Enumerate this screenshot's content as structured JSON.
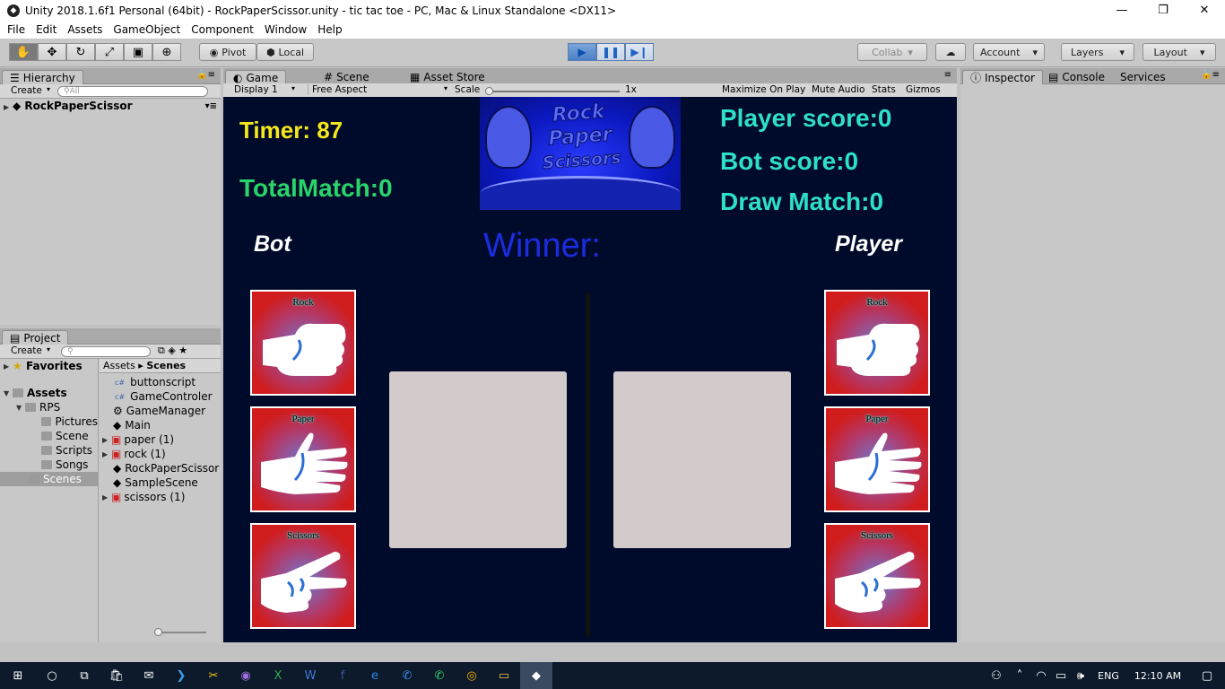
{
  "window": {
    "title": "Unity 2018.1.6f1 Personal (64bit) - RockPaperScissor.unity - tic tac toe - PC, Mac & Linux Standalone <DX11>"
  },
  "menu": [
    "File",
    "Edit",
    "Assets",
    "GameObject",
    "Component",
    "Window",
    "Help"
  ],
  "toolbar": {
    "pivot": "Pivot",
    "local": "Local",
    "collab": "Collab",
    "account": "Account",
    "layers": "Layers",
    "layout": "Layout"
  },
  "hierarchy": {
    "tab": "Hierarchy",
    "create": "Create",
    "search_placeholder": "All",
    "scene": "RockPaperScissor"
  },
  "game_tabs": {
    "game": "Game",
    "scene": "Scene",
    "asset_store": "Asset Store"
  },
  "game_bar": {
    "display": "Display 1",
    "aspect": "Free Aspect",
    "scale_label": "Scale",
    "scale_value": "1x",
    "maximize": "Maximize On Play",
    "mute": "Mute Audio",
    "stats": "Stats",
    "gizmos": "Gizmos"
  },
  "inspector": {
    "tab": "Inspector",
    "console": "Console",
    "services": "Services"
  },
  "project": {
    "tab": "Project",
    "create": "Create",
    "favorites": "Favorites",
    "assets": "Assets",
    "rps": "RPS",
    "folders": [
      "Pictures",
      "Scene",
      "Scripts",
      "Songs",
      "Scenes"
    ],
    "breadcrumb_root": "Assets",
    "breadcrumb_current": "Scenes",
    "files": [
      "buttonscript",
      "GameControler",
      "GameManager",
      "Main",
      "paper (1)",
      "rock (1)",
      "RockPaperScissor",
      "SampleScene",
      "scissors (1)"
    ]
  },
  "game": {
    "timer": "Timer: 87",
    "total_match": "TotalMatch:0",
    "player_score": "Player score:0",
    "bot_score": "Bot score:0",
    "draw_match": "Draw Match:0",
    "bot_label": "Bot",
    "player_label": "Player",
    "winner": "Winner:",
    "banner_line1": "Rock",
    "banner_line2": "Paper",
    "banner_line3": "Scissors",
    "card_labels": [
      "Rock",
      "Paper",
      "Scissors"
    ],
    "colors": {
      "background": "#000a2a",
      "timer": "#f5e71c",
      "green": "#29d46b",
      "cyan": "#2de0c6",
      "winner": "#1b2de0",
      "card_red": "#d01c1c"
    }
  },
  "taskbar": {
    "language": "ENG",
    "time": "12:10 AM"
  }
}
